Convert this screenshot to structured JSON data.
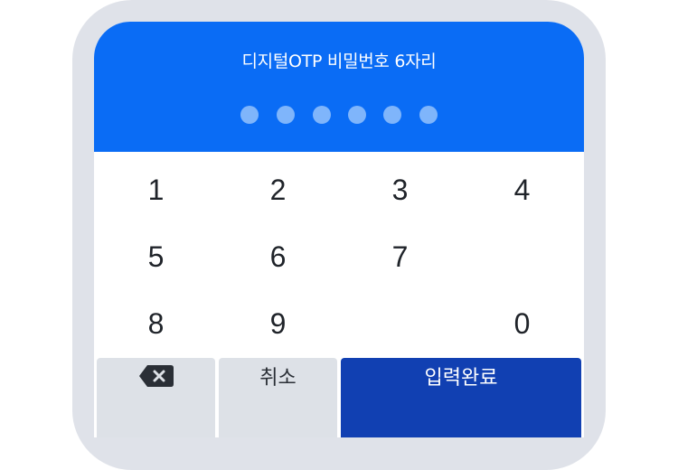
{
  "header": {
    "title": "디지털OTP 비밀번호 6자리",
    "pin_length": 6,
    "pin_entered": 0
  },
  "keypad": {
    "rows": [
      [
        "1",
        "2",
        "3",
        "4"
      ],
      [
        "5",
        "6",
        "7",
        ""
      ],
      [
        "8",
        "9",
        "",
        "0"
      ]
    ]
  },
  "actions": {
    "backspace_icon": "backspace-icon",
    "cancel_label": "취소",
    "confirm_label": "입력완료"
  },
  "colors": {
    "header_bg": "#0a6cf5",
    "pin_dot": "#7fb5fb",
    "confirm_bg": "#1140b2",
    "secondary_bg": "#dde1e7",
    "frame": "#dfe2e9"
  }
}
